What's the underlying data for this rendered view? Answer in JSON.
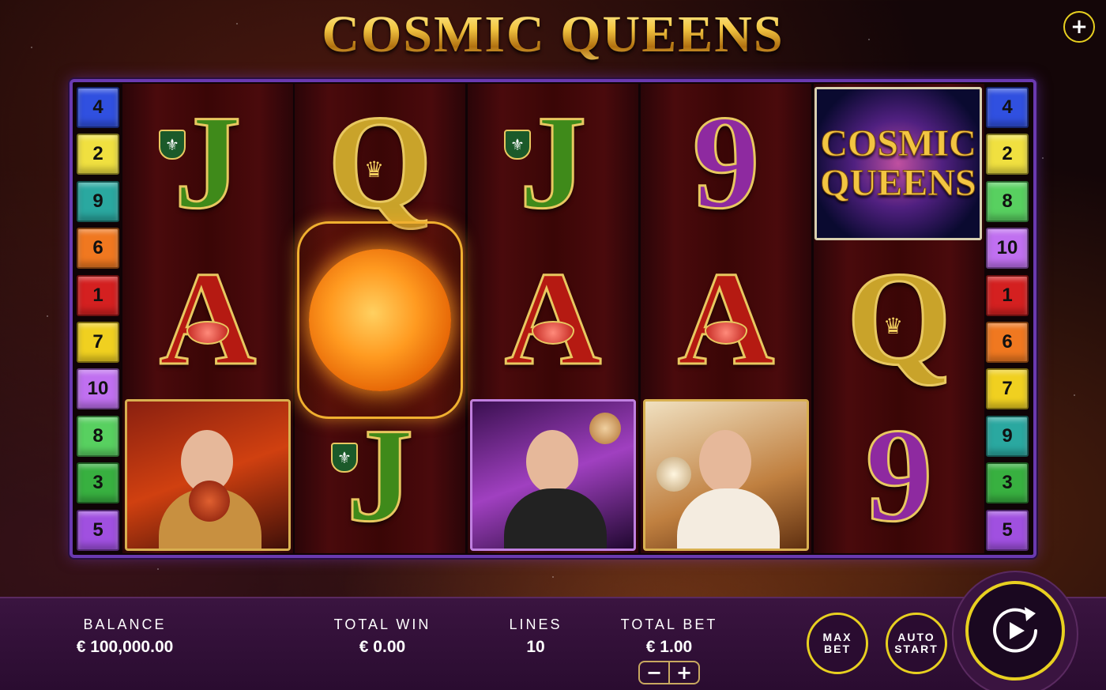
{
  "title": "COSMIC QUEENS",
  "top_plus": "+",
  "paylines_left": [
    "4",
    "2",
    "9",
    "6",
    "1",
    "7",
    "10",
    "8",
    "3",
    "5"
  ],
  "paylines_right": [
    "4",
    "2",
    "8",
    "10",
    "1",
    "6",
    "7",
    "9",
    "3",
    "5"
  ],
  "payline_colors": {
    "1": "#d42020",
    "2": "#f0e040",
    "3": "#38b040",
    "4": "#3050e0",
    "5": "#a050e0",
    "6": "#f07820",
    "7": "#f0d020",
    "8": "#58d060",
    "9": "#2aa8a0",
    "10": "#c070f0"
  },
  "reels": [
    [
      "J",
      "A",
      "queen-portrait-red"
    ],
    [
      "Q",
      "sun-wild",
      "J"
    ],
    [
      "J",
      "A",
      "queen-portrait-purple"
    ],
    [
      "9",
      "A",
      "queen-portrait-gold"
    ],
    [
      "scatter",
      "Q",
      "9"
    ]
  ],
  "scatter": {
    "line1": "COSMIC",
    "line2": "QUEENS"
  },
  "stats": {
    "balance_label": "BALANCE",
    "balance_value": "€ 100,000.00",
    "total_win_label": "TOTAL WIN",
    "total_win_value": "€ 0.00",
    "lines_label": "LINES",
    "lines_value": "10",
    "total_bet_label": "TOTAL BET",
    "total_bet_value": "€ 1.00"
  },
  "stepper": {
    "minus": "−",
    "plus": "+"
  },
  "buttons": {
    "max_bet_line1": "MAX",
    "max_bet_line2": "BET",
    "auto_start_line1": "AUTO",
    "auto_start_line2": "START"
  }
}
